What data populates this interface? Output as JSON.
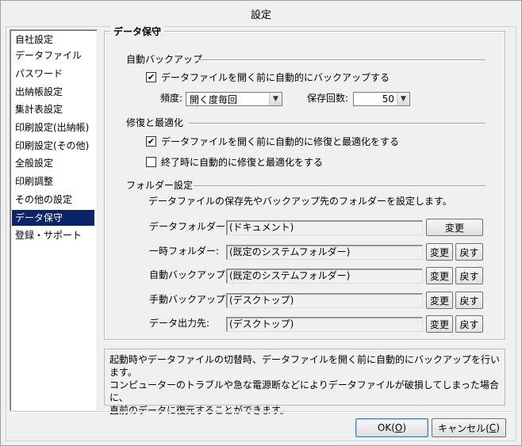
{
  "window": {
    "title": "設定"
  },
  "sidebar": {
    "items": [
      {
        "label": "自社設定"
      },
      {
        "label": "データファイル"
      },
      {
        "label": "パスワード"
      },
      {
        "label": "出納帳設定"
      },
      {
        "label": "集計表設定"
      },
      {
        "label": "印刷設定(出納帳)"
      },
      {
        "label": "印刷設定(その他)"
      },
      {
        "label": "全般設定"
      },
      {
        "label": "印刷調整"
      },
      {
        "label": "その他の設定"
      },
      {
        "label": "データ保守",
        "selected": true
      },
      {
        "label": "登録・サポート"
      }
    ]
  },
  "panel": {
    "title": "データ保守",
    "auto_backup": {
      "heading": "自動バックアップ",
      "checkbox_label": "データファイルを開く前に自動的にバックアップする",
      "checked": true,
      "frequency_label": "頻度:",
      "frequency_value": "開く度毎回",
      "count_label": "保存回数:",
      "count_value": "50"
    },
    "repair": {
      "heading": "修復と最適化",
      "before_open_label": "データファイルを開く前に自動的に修復と最適化をする",
      "before_open_checked": true,
      "on_exit_label": "終了時に自動的に修復と最適化をする",
      "on_exit_checked": false
    },
    "folders": {
      "heading": "フォルダー設定",
      "intro": "データファイルの保存先やバックアップ先のフォルダーを設定します。",
      "change_label": "変更",
      "reset_label": "戻す",
      "rows": [
        {
          "label": "データフォルダー:",
          "value": "(ドキュメント)",
          "has_reset": false
        },
        {
          "label": "一時フォルダー:",
          "value": "(既定のシステムフォルダー)",
          "has_reset": true
        },
        {
          "label": "自動バックアップ:",
          "value": "(既定のシステムフォルダー)",
          "has_reset": true
        },
        {
          "label": "手動バックアップ:",
          "value": "(デスクトップ)",
          "has_reset": true
        },
        {
          "label": "データ出力先:",
          "value": "(デスクトップ)",
          "has_reset": true
        }
      ]
    }
  },
  "description": {
    "lines": [
      "起動時やデータファイルの切替時、データファイルを開く前に自動的にバックアップを行います。",
      "コンピューターのトラブルや急な電源断などによりデータファイルが破損してしまった場合に、",
      "直前のデータに復元することができます。"
    ]
  },
  "footer": {
    "ok_label": "OK(",
    "ok_key": "O",
    "ok_suffix": ")",
    "cancel_label": "キャンセル(",
    "cancel_key": "C",
    "cancel_suffix": ")"
  }
}
